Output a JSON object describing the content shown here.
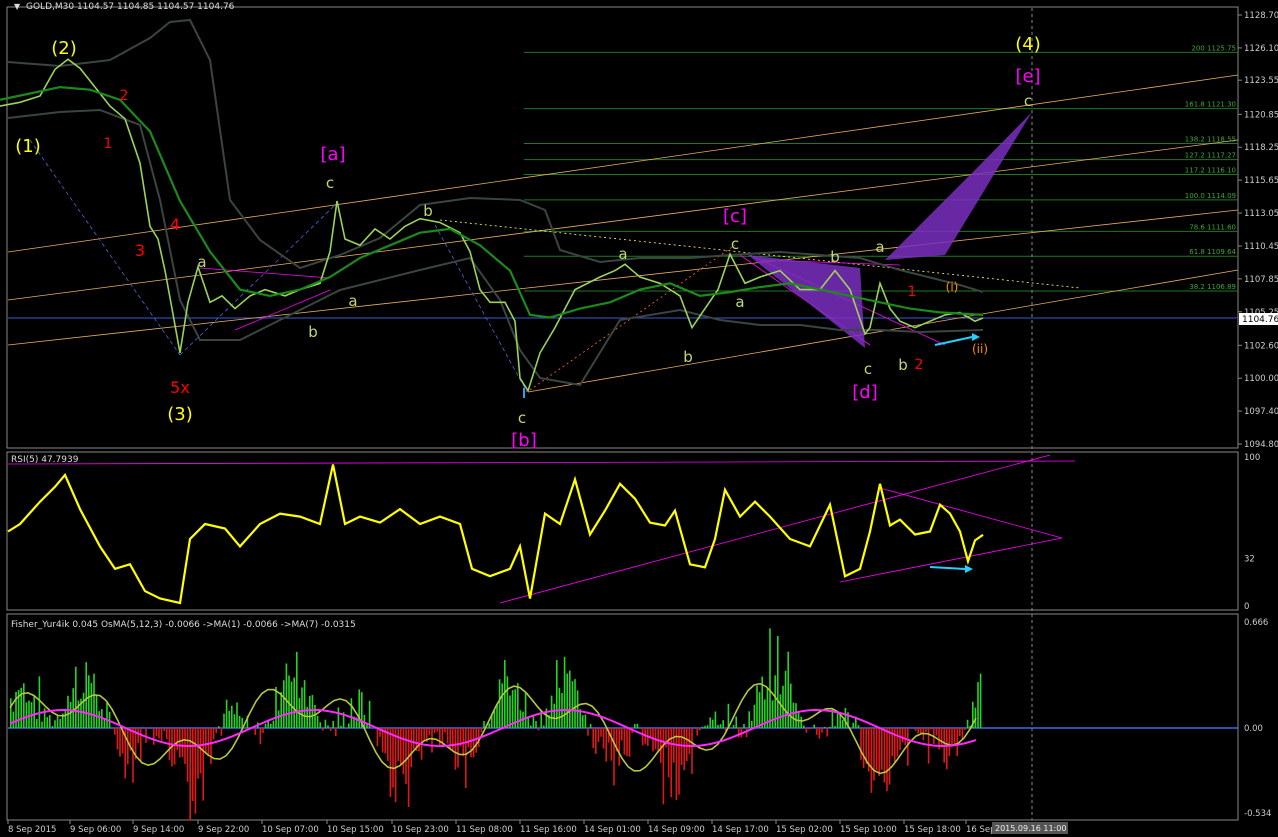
{
  "chart_data": [
    {
      "type": "line",
      "title": "GOLD,M30  1104.57 1104.85 1104.57 1104.76",
      "symbol": "GOLD,M30",
      "last_price": "1104.76",
      "ylim": [
        1094.8,
        1128.7
      ],
      "y_ticks": [
        "1128.70",
        "1126.10",
        "1123.55",
        "1120.85",
        "1118.25",
        "1115.65",
        "1113.05",
        "1110.45",
        "1107.85",
        "1105.25",
        "1102.60",
        "1100.00",
        "1097.40",
        "1094.80"
      ],
      "x_ticks": [
        "8 Sep 2015",
        "9 Sep 06:00",
        "9 Sep 14:00",
        "9 Sep 22:00",
        "10 Sep 07:00",
        "10 Sep 15:00",
        "10 Sep 23:00",
        "11 Sep 08:00",
        "11 Sep 16:00",
        "14 Sep 01:00",
        "14 Sep 09:00",
        "14 Sep 17:00",
        "15 Sep 02:00",
        "15 Sep 10:00",
        "15 Sep 18:00",
        "16 Sep"
      ],
      "cursor_time": "2015.09.16 11:00",
      "grid": false,
      "series": [
        {
          "name": "",
          "color": "#9bd35a",
          "points": [
            [
              0,
              1121.5
            ],
            [
              20,
              1121.8
            ],
            [
              40,
              1122.3
            ],
            [
              55,
              1124.4
            ],
            [
              68,
              1125.2
            ],
            [
              80,
              1124.5
            ],
            [
              95,
              1123.0
            ],
            [
              110,
              1121.5
            ],
            [
              125,
              1120.5
            ],
            [
              140,
              1117.0
            ],
            [
              150,
              1112.0
            ],
            [
              158,
              1111.0
            ],
            [
              165,
              1108.5
            ],
            [
              172,
              1105.5
            ],
            [
              180,
              1102.0
            ],
            [
              188,
              1106.0
            ],
            [
              198,
              1108.8
            ],
            [
              210,
              1106.0
            ],
            [
              222,
              1106.5
            ],
            [
              235,
              1105.5
            ],
            [
              250,
              1106.5
            ],
            [
              265,
              1107.0
            ],
            [
              285,
              1106.5
            ],
            [
              300,
              1107.0
            ],
            [
              320,
              1107.5
            ],
            [
              330,
              1110.0
            ],
            [
              337,
              1114.0
            ],
            [
              345,
              1111.0
            ],
            [
              360,
              1110.5
            ],
            [
              375,
              1111.8
            ],
            [
              390,
              1111.0
            ],
            [
              405,
              1112.0
            ],
            [
              420,
              1112.6
            ],
            [
              440,
              1112.3
            ],
            [
              460,
              1111.5
            ],
            [
              470,
              1110.0
            ],
            [
              480,
              1107.0
            ],
            [
              490,
              1106.0
            ],
            [
              505,
              1106.0
            ],
            [
              515,
              1104.5
            ],
            [
              520,
              1100.0
            ],
            [
              528,
              1099.0
            ],
            [
              540,
              1102.0
            ],
            [
              555,
              1104.0
            ],
            [
              575,
              1107.0
            ],
            [
              600,
              1108.0
            ],
            [
              615,
              1108.5
            ],
            [
              625,
              1109.0
            ],
            [
              640,
              1108.0
            ],
            [
              660,
              1107.5
            ],
            [
              680,
              1106.5
            ],
            [
              692,
              1104.0
            ],
            [
              705,
              1105.5
            ],
            [
              718,
              1107.0
            ],
            [
              730,
              1109.8
            ],
            [
              745,
              1107.5
            ],
            [
              760,
              1108.0
            ],
            [
              780,
              1108.5
            ],
            [
              800,
              1107.0
            ],
            [
              820,
              1107.0
            ],
            [
              835,
              1108.5
            ],
            [
              850,
              1107.0
            ],
            [
              865,
              1103.5
            ],
            [
              870,
              1104.0
            ],
            [
              880,
              1107.5
            ],
            [
              890,
              1105.5
            ],
            [
              900,
              1104.5
            ],
            [
              915,
              1104.0
            ],
            [
              930,
              1104.5
            ],
            [
              945,
              1105.0
            ],
            [
              960,
              1105.2
            ],
            [
              975,
              1104.5
            ],
            [
              983,
              1104.76
            ]
          ]
        },
        {
          "name": "",
          "color": "#1b8a1b",
          "points": [
            [
              0,
              1122.0
            ],
            [
              30,
              1122.5
            ],
            [
              60,
              1123.0
            ],
            [
              90,
              1122.8
            ],
            [
              120,
              1122.0
            ],
            [
              150,
              1119.5
            ],
            [
              180,
              1114.0
            ],
            [
              210,
              1110.0
            ],
            [
              240,
              1107.0
            ],
            [
              270,
              1106.5
            ],
            [
              300,
              1107.0
            ],
            [
              330,
              1108.0
            ],
            [
              360,
              1109.5
            ],
            [
              390,
              1110.5
            ],
            [
              420,
              1111.5
            ],
            [
              450,
              1111.8
            ],
            [
              480,
              1110.5
            ],
            [
              510,
              1108.5
            ],
            [
              530,
              1105.0
            ],
            [
              550,
              1104.8
            ],
            [
              580,
              1105.5
            ],
            [
              610,
              1106.0
            ],
            [
              640,
              1107.0
            ],
            [
              670,
              1107.5
            ],
            [
              700,
              1106.5
            ],
            [
              730,
              1106.8
            ],
            [
              760,
              1107.2
            ],
            [
              790,
              1107.5
            ],
            [
              820,
              1107.0
            ],
            [
              850,
              1106.5
            ],
            [
              880,
              1106.0
            ],
            [
              910,
              1105.5
            ],
            [
              940,
              1105.2
            ],
            [
              983,
              1105.0
            ]
          ]
        }
      ]
    },
    {
      "type": "line",
      "title": "RSI(5) 47.7939",
      "ylim": [
        0,
        100
      ],
      "y_ticks": [
        "100",
        "32",
        "0"
      ],
      "series": [
        {
          "name": "",
          "color": "#ffff00",
          "points": [
            [
              8,
              50
            ],
            [
              20,
              55
            ],
            [
              40,
              70
            ],
            [
              55,
              80
            ],
            [
              65,
              88
            ],
            [
              80,
              65
            ],
            [
              100,
              40
            ],
            [
              115,
              25
            ],
            [
              130,
              28
            ],
            [
              145,
              10
            ],
            [
              160,
              5
            ],
            [
              180,
              2
            ],
            [
              190,
              45
            ],
            [
              205,
              55
            ],
            [
              225,
              52
            ],
            [
              240,
              40
            ],
            [
              260,
              55
            ],
            [
              280,
              62
            ],
            [
              300,
              60
            ],
            [
              320,
              55
            ],
            [
              333,
              95
            ],
            [
              345,
              55
            ],
            [
              360,
              60
            ],
            [
              380,
              56
            ],
            [
              400,
              65
            ],
            [
              420,
              55
            ],
            [
              440,
              60
            ],
            [
              460,
              55
            ],
            [
              472,
              25
            ],
            [
              490,
              20
            ],
            [
              510,
              25
            ],
            [
              520,
              40
            ],
            [
              530,
              5
            ],
            [
              545,
              62
            ],
            [
              560,
              55
            ],
            [
              575,
              85
            ],
            [
              590,
              48
            ],
            [
              605,
              64
            ],
            [
              620,
              82
            ],
            [
              635,
              72
            ],
            [
              650,
              56
            ],
            [
              665,
              54
            ],
            [
              675,
              64
            ],
            [
              690,
              28
            ],
            [
              705,
              26
            ],
            [
              715,
              45
            ],
            [
              725,
              78
            ],
            [
              740,
              60
            ],
            [
              755,
              70
            ],
            [
              770,
              60
            ],
            [
              790,
              45
            ],
            [
              810,
              40
            ],
            [
              830,
              68
            ],
            [
              845,
              20
            ],
            [
              860,
              25
            ],
            [
              870,
              50
            ],
            [
              880,
              82
            ],
            [
              890,
              54
            ],
            [
              900,
              58
            ],
            [
              915,
              48
            ],
            [
              930,
              50
            ],
            [
              940,
              68
            ],
            [
              950,
              62
            ],
            [
              960,
              50
            ],
            [
              968,
              30
            ],
            [
              975,
              44
            ],
            [
              983,
              47.79
            ]
          ]
        }
      ]
    },
    {
      "type": "bar",
      "title": "Fisher_Yur4ik 0.045  OsMA(5,12,3) -0.0066  ->MA(1) -0.0066  ->MA(7) -0.0315",
      "ylim": [
        -0.534,
        0.666
      ],
      "y_ticks": [
        "0.666",
        "0.00",
        "-0.534"
      ]
    }
  ],
  "wave_labels": [
    {
      "text": "(2)",
      "color": "#ffff00"
    },
    {
      "text": "(1)",
      "color": "#ffff00"
    },
    {
      "text": "2",
      "color": "#ff0000"
    },
    {
      "text": "1",
      "color": "#ff0000"
    },
    {
      "text": "3",
      "color": "#ff0000"
    },
    {
      "text": "4",
      "color": "#ff0000"
    },
    {
      "text": "a",
      "color": "#c0d870"
    },
    {
      "text": "b",
      "color": "#c0d870"
    },
    {
      "text": "5x",
      "color": "#ff0000"
    },
    {
      "text": "(3)",
      "color": "#ffff00"
    },
    {
      "text": "[a]",
      "color": "#ff00ff"
    },
    {
      "text": "c",
      "color": "#c0d870"
    },
    {
      "text": "a",
      "color": "#c0d870"
    },
    {
      "text": "b",
      "color": "#c0d870"
    },
    {
      "text": "c",
      "color": "#c0d870"
    },
    {
      "text": "[b]",
      "color": "#ff00ff"
    },
    {
      "text": "a",
      "color": "#c0d870"
    },
    {
      "text": "b",
      "color": "#c0d870"
    },
    {
      "text": "[c]",
      "color": "#ff00ff"
    },
    {
      "text": "c",
      "color": "#c0d870"
    },
    {
      "text": "a",
      "color": "#c0d870"
    },
    {
      "text": "b",
      "color": "#c0d870"
    },
    {
      "text": "a",
      "color": "#c0d870"
    },
    {
      "text": "c",
      "color": "#c0d870"
    },
    {
      "text": "[d]",
      "color": "#ff00ff"
    },
    {
      "text": "b",
      "color": "#c0d870"
    },
    {
      "text": "2",
      "color": "#ff0000"
    },
    {
      "text": "1",
      "color": "#ff0000"
    },
    {
      "text": "(i)",
      "color": "#ff8c00"
    },
    {
      "text": "(ii)",
      "color": "#ff8c00"
    },
    {
      "text": "(4)",
      "color": "#ffff00"
    },
    {
      "text": "[e]",
      "color": "#ff00ff"
    },
    {
      "text": "c",
      "color": "#c0d870"
    }
  ],
  "fib_levels": [
    {
      "label": "200 1125.75"
    },
    {
      "label": "161.8 1121.30"
    },
    {
      "label": "138.2 1118.55"
    },
    {
      "label": "127.2 1117.27"
    },
    {
      "label": "117.2 1116.10"
    },
    {
      "label": "100.0 1114.09"
    },
    {
      "label": "78.6 1111.60"
    },
    {
      "label": "61.8 1109.64"
    },
    {
      "label": "38.2 1106.89"
    }
  ],
  "colors": {
    "background": "#000000",
    "grid_fib": "#1f7a1f",
    "channel": "#e8b060",
    "envelope": "#3a4540",
    "magenta": "#ff00ff",
    "purple": "#7b2fbf"
  }
}
